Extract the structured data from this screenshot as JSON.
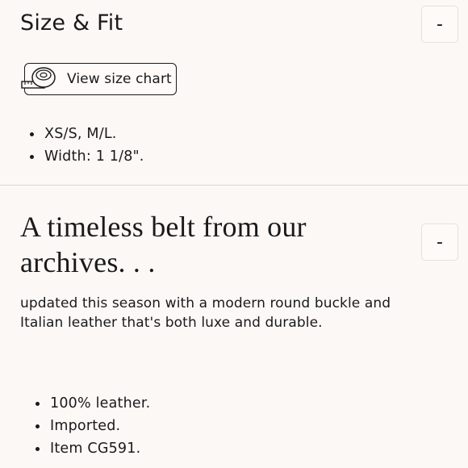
{
  "size_fit": {
    "title": "Size & Fit",
    "toggle_label": "-",
    "size_chart_button": {
      "label": "View size chart",
      "icon": "measuring-tape-icon"
    },
    "bullets": [
      "XS/S, M/L.",
      "Width: 1 1/8\"."
    ]
  },
  "details": {
    "title": "A timeless belt from our archives. . .",
    "toggle_label": "-",
    "description": "updated this season with a modern round buckle and Italian leather that's both luxe and durable.",
    "bullets": [
      "100% leather.",
      "Imported.",
      "Item CG591."
    ]
  }
}
